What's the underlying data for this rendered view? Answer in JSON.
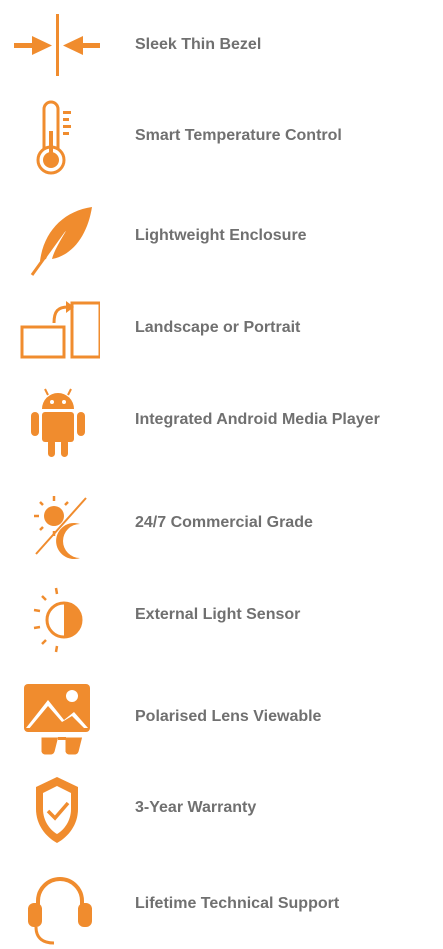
{
  "accent": "#F08C2E",
  "text_color": "#707070",
  "features": [
    {
      "icon": "thin-bezel-icon",
      "label": "Sleek Thin Bezel"
    },
    {
      "icon": "thermometer-icon",
      "label": "Smart Temperature Control"
    },
    {
      "icon": "feather-icon",
      "label": "Lightweight Enclosure"
    },
    {
      "icon": "rotate-screen-icon",
      "label": "Landscape or Portrait"
    },
    {
      "icon": "android-icon",
      "label": "Integrated Android Media Player"
    },
    {
      "icon": "sun-moon-icon",
      "label": "24/7 Commercial Grade"
    },
    {
      "icon": "light-sensor-icon",
      "label": "External Light Sensor"
    },
    {
      "icon": "polarised-glasses-icon",
      "label": "Polarised Lens Viewable"
    },
    {
      "icon": "shield-check-icon",
      "label": "3-Year Warranty"
    },
    {
      "icon": "headset-icon",
      "label": "Lifetime Technical Support"
    }
  ]
}
